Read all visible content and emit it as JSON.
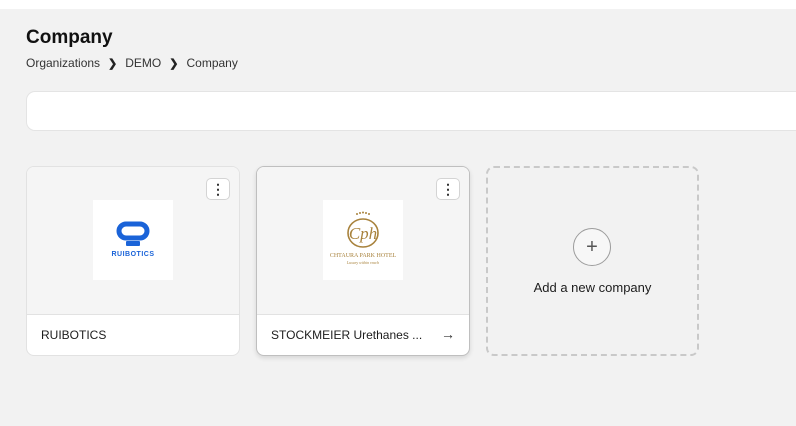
{
  "header": {
    "title": "Company",
    "breadcrumb": [
      "Organizations",
      "DEMO",
      "Company"
    ]
  },
  "search": {
    "value": "",
    "placeholder": ""
  },
  "companies": [
    {
      "name": "RUIBOTICS",
      "logo_text": "RUIBOTICS",
      "logo_color": "#1a63d8"
    },
    {
      "name": "STOCKMEIER Urethanes ...",
      "logo_text": "CHTAURA PARK HOTEL",
      "logo_tagline": "Luxury within reach",
      "logo_color": "#a8823c",
      "logo_monogram": "Cph"
    }
  ],
  "add_card": {
    "label": "Add a new company",
    "icon": "plus-icon"
  },
  "icons": {
    "menu": "more-vertical-icon",
    "arrow": "arrow-right-icon",
    "breadcrumb_separator": "chevron-right-icon"
  },
  "colors": {
    "background": "#f2f2f2",
    "card": "#ffffff",
    "border": "#e2e2e2"
  }
}
